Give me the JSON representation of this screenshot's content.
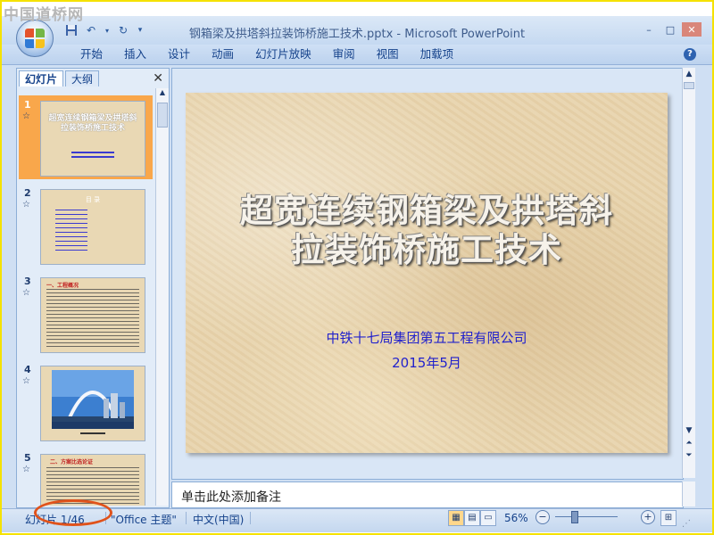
{
  "watermark": "中国道桥网",
  "window": {
    "title": "钢箱梁及拱塔斜拉装饰桥施工技术.pptx - Microsoft PowerPoint",
    "minimize_glyph": "–",
    "maximize_glyph": "□",
    "close_glyph": "✕"
  },
  "ribbon": {
    "tabs": [
      "开始",
      "插入",
      "设计",
      "动画",
      "幻灯片放映",
      "审阅",
      "视图",
      "加载项"
    ],
    "help_glyph": "?"
  },
  "panel": {
    "tabs": [
      "幻灯片",
      "大纲"
    ],
    "close_glyph": "✕",
    "thumbnails": [
      {
        "number": "1",
        "title": "超宽连续钢箱梁及拱塔斜拉装饰桥施工技术",
        "selected": true
      },
      {
        "number": "2",
        "title": "目 录"
      },
      {
        "number": "3",
        "title": "一、工程概况"
      },
      {
        "number": "4"
      },
      {
        "number": "5",
        "title": "二、方案比选论证"
      }
    ],
    "star_glyph": "☆"
  },
  "slide": {
    "title_line1": "超宽连续钢箱梁及拱塔斜",
    "title_line2": "拉装饰桥施工技术",
    "company": "中铁十七局集团第五工程有限公司",
    "date": "2015年5月"
  },
  "notes": {
    "placeholder": "单击此处添加备注"
  },
  "status": {
    "slide_counter": "幻灯片 1/46",
    "theme": "\"Office 主题\"",
    "language": "中文(中国)",
    "zoom": "56%",
    "zoom_minus": "−",
    "zoom_plus": "+"
  },
  "colors": {
    "frame_border": "#f5e200",
    "selected_thumb": "#f9a74b",
    "slide_bg": "#e8d4ad",
    "subtitle_text": "#2222cc",
    "annotation_circle": "#e0521b"
  }
}
